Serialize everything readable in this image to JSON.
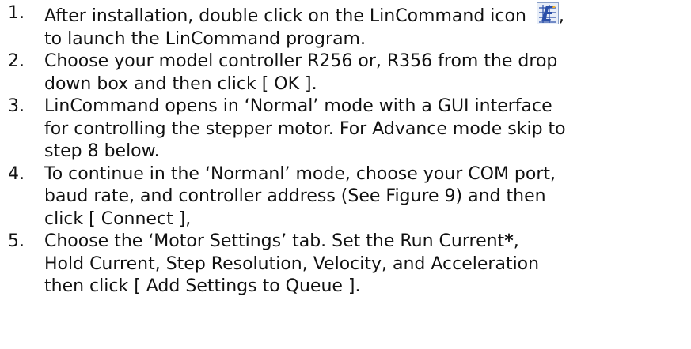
{
  "steps": [
    {
      "num": "1.",
      "lines": [
        "After installation, double click on the LinCommand icon ",
        "to launch the LinCommand program."
      ],
      "after_icon": ","
    },
    {
      "num": "2.",
      "lines": [
        "Choose your model controller R256 or, R356 from the drop",
        "down box and then click [ OK ]."
      ]
    },
    {
      "num": "3.",
      "lines": [
        "LinCommand opens in ‘Normal’ mode with a GUI interface",
        "for controlling the stepper motor.  For Advance mode skip to",
        "step 8 below."
      ]
    },
    {
      "num": "4.",
      "lines": [
        "To continue in the ‘Normanl’ mode, choose your COM port,",
        "baud rate, and controller address (See Figure 9) and then",
        "click [ Connect ],"
      ]
    },
    {
      "num": "5.",
      "line1_a": "Choose the ‘Motor Settings’ tab. Set the Run Current",
      "line1_star": "*",
      "line1_b": ",",
      "lines_rest": [
        "Hold Current, Step Resolution, Velocity, and Acceleration",
        "then click [ Add Settings to Queue ]."
      ]
    }
  ],
  "icon": {
    "name": "lincommand-icon",
    "color_bg": "#e8eef8",
    "color_fg": "#2a4fa8",
    "color_accent": "#f0b030"
  }
}
